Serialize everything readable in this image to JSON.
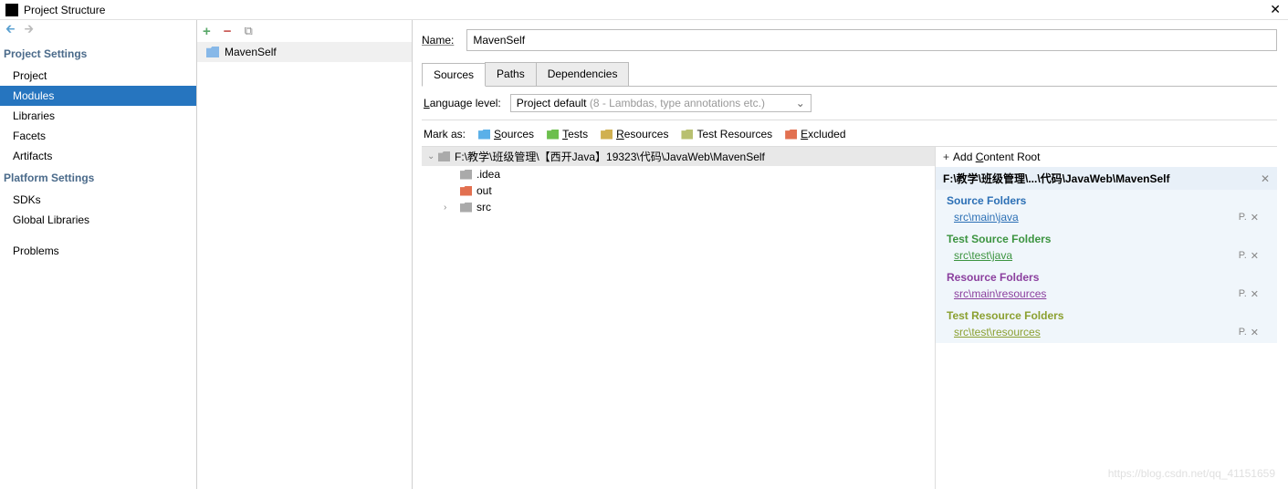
{
  "window": {
    "title": "Project Structure",
    "close": "✕"
  },
  "sidebar": {
    "sections": [
      {
        "header": "Project Settings",
        "items": [
          "Project",
          "Modules",
          "Libraries",
          "Facets",
          "Artifacts"
        ],
        "selected": "Modules"
      },
      {
        "header": "Platform Settings",
        "items": [
          "SDKs",
          "Global Libraries"
        ]
      },
      {
        "header": "",
        "items": [
          "Problems"
        ]
      }
    ]
  },
  "modules": {
    "items": [
      "MavenSelf"
    ]
  },
  "detail": {
    "nameLabel": "Name:",
    "nameValue": "MavenSelf",
    "tabs": [
      "Sources",
      "Paths",
      "Dependencies"
    ],
    "activeTab": "Sources",
    "langLabel": "Language level:",
    "langValue": "Project default",
    "langHint": "(8 - Lambdas, type annotations etc.)",
    "markAsLabel": "Mark as:",
    "markAs": [
      {
        "letter": "S",
        "rest": "ources",
        "cls": "sources"
      },
      {
        "letter": "T",
        "rest": "ests",
        "cls": "tests"
      },
      {
        "letter": "R",
        "rest": "esources",
        "cls": "resources"
      },
      {
        "letter": "",
        "rest": "Test Resources",
        "cls": "testres"
      },
      {
        "letter": "E",
        "rest": "xcluded",
        "cls": "excluded"
      }
    ],
    "tree": {
      "root": "F:\\教学\\班级管理\\【西开Java】19323\\代码\\JavaWeb\\MavenSelf",
      "children": [
        {
          "name": ".idea",
          "iconCls": "grey",
          "expand": ""
        },
        {
          "name": "out",
          "iconCls": "out",
          "expand": ""
        },
        {
          "name": "src",
          "iconCls": "grey",
          "expand": "›"
        }
      ]
    },
    "rightPanel": {
      "addRoot": "Add Content Root",
      "contentRoot": "F:\\教学\\班级管理\\...\\代码\\JavaWeb\\MavenSelf",
      "sections": [
        {
          "title": "Source Folders",
          "cls": "src",
          "paths": [
            "src\\main\\java"
          ]
        },
        {
          "title": "Test Source Folders",
          "cls": "test",
          "paths": [
            "src\\test\\java"
          ]
        },
        {
          "title": "Resource Folders",
          "cls": "res",
          "paths": [
            "src\\main\\resources"
          ]
        },
        {
          "title": "Test Resource Folders",
          "cls": "testres",
          "paths": [
            "src\\test\\resources"
          ]
        }
      ]
    }
  },
  "watermark": "https://blog.csdn.net/qq_41151659"
}
